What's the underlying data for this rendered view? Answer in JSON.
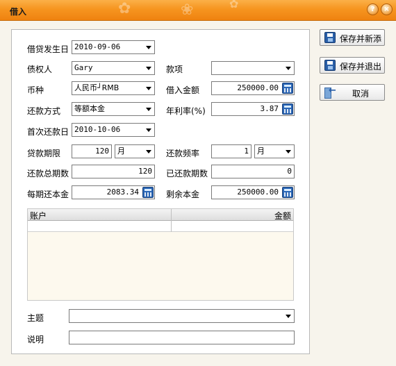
{
  "window": {
    "title": "借入",
    "help_btn": "?",
    "close_btn": "×"
  },
  "form": {
    "loan_date": {
      "label": "借贷发生日",
      "value": "2010-09-06"
    },
    "creditor": {
      "label": "债权人",
      "value": "Gary"
    },
    "account_item": {
      "label": "款项",
      "value": ""
    },
    "currency": {
      "label": "币种",
      "value": "人民币┘RMB"
    },
    "loan_amount": {
      "label": "借入金额",
      "value": "250000.00"
    },
    "repay_method": {
      "label": "还款方式",
      "value": "等额本金"
    },
    "annual_rate": {
      "label": "年利率(%)",
      "value": "3.87"
    },
    "first_repay_date": {
      "label": "首次还款日",
      "value": "2010-10-06"
    },
    "loan_term": {
      "label": "贷款期限",
      "value": "120",
      "unit": "月"
    },
    "repay_freq": {
      "label": "还款频率",
      "value": "1",
      "unit": "月"
    },
    "total_periods": {
      "label": "还款总期数",
      "value": "120"
    },
    "paid_periods": {
      "label": "已还款期数",
      "value": "0"
    },
    "principal_per_period": {
      "label": "每期还本金",
      "value": "2083.34"
    },
    "remaining_principal": {
      "label": "剩余本金",
      "value": "250000.00"
    },
    "subject": {
      "label": "主题",
      "value": ""
    },
    "note": {
      "label": "说明",
      "value": ""
    }
  },
  "grid": {
    "col_account": "账户",
    "col_amount": "金额"
  },
  "buttons": {
    "save_new": "保存并新添",
    "save_exit": "保存并退出",
    "cancel": "取消"
  }
}
